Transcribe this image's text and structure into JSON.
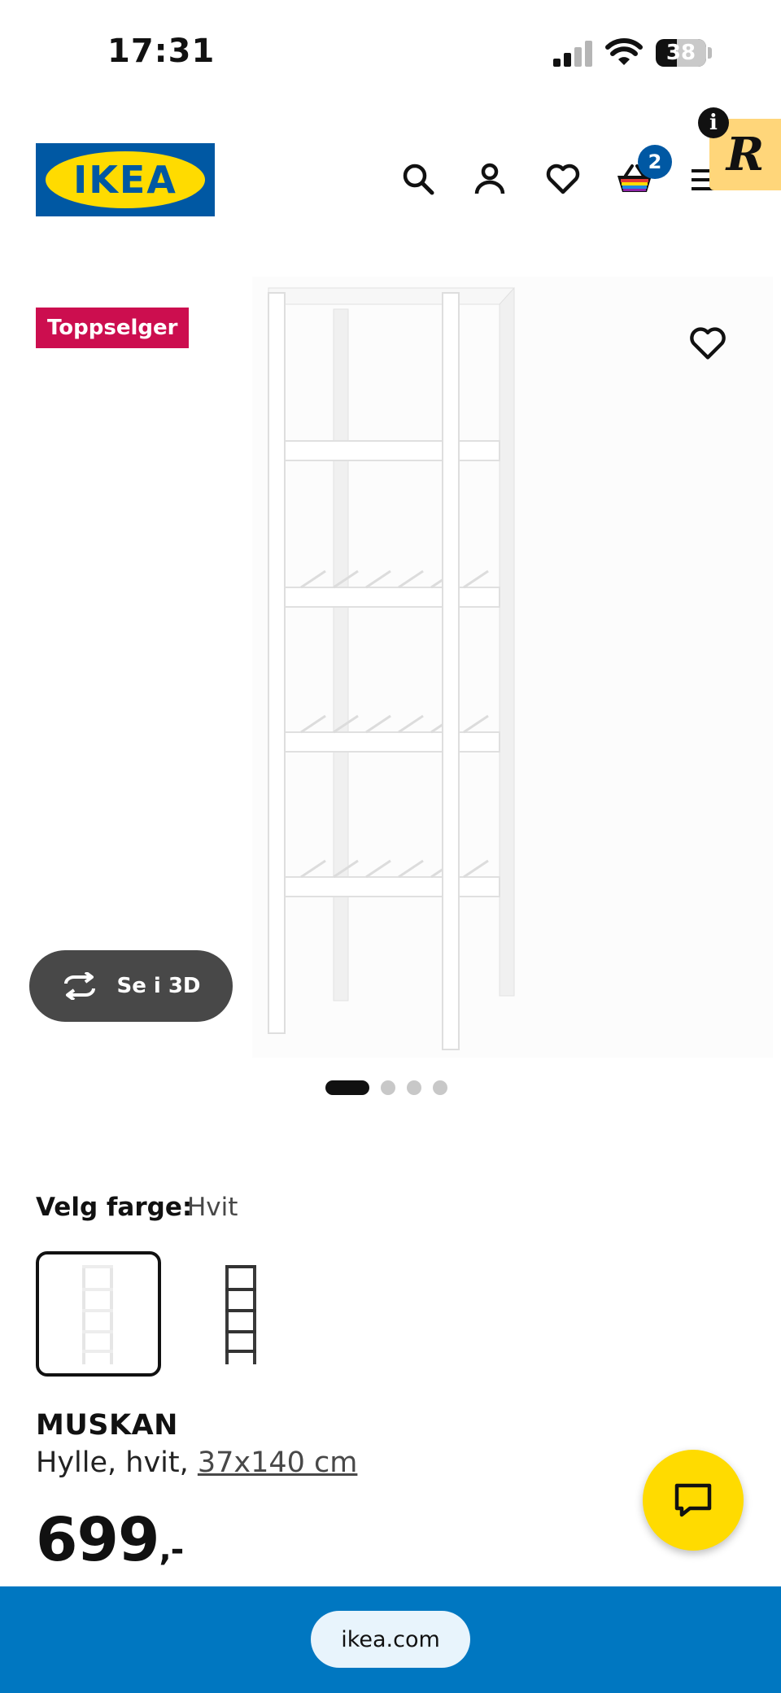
{
  "status_bar": {
    "time": "17:31",
    "battery": "38"
  },
  "header": {
    "logo_text": "IKEA",
    "cart_count": "2",
    "icons": [
      "search-icon",
      "account-icon",
      "wishlist-icon",
      "cart-icon",
      "menu-icon"
    ],
    "extension_letter": "R",
    "info_letter": "i"
  },
  "product_image": {
    "badge": "Toppselger",
    "view_3d_label": "Se i 3D",
    "carousel_dots": 4,
    "active_dot": 0
  },
  "color_choice": {
    "label": "Velg farge:",
    "value": "Hvit",
    "options": [
      "Hvit",
      "Svart"
    ]
  },
  "product": {
    "name": "MUSKAN",
    "desc_prefix": "Hylle, hvit, ",
    "size_link": "37x140 cm",
    "price": "699",
    "price_suffix": ",-"
  },
  "browser": {
    "url": "ikea.com"
  },
  "colors": {
    "ikea_blue": "#0058a3",
    "ikea_yellow": "#ffdb00",
    "badge_red": "#cc0e4f",
    "browser_bar": "#0077c1"
  }
}
